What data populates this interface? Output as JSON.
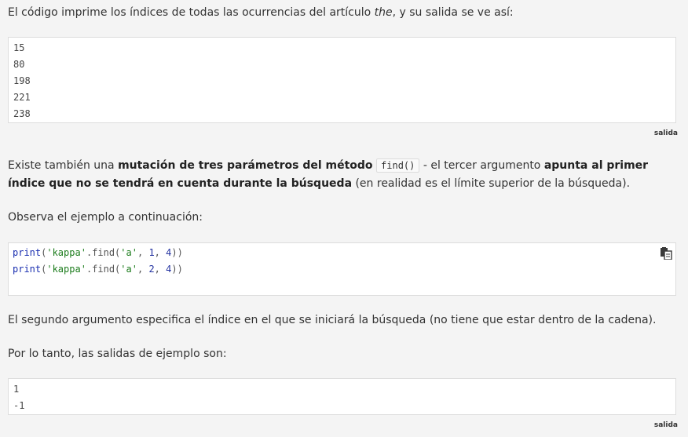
{
  "intro": {
    "pre": "El código imprime los índices de todas las ocurrencias del artículo ",
    "italic": "the",
    "post": ", y su salida se ve así:"
  },
  "output1": {
    "lines": [
      "15",
      "80",
      "198",
      "221",
      "238"
    ],
    "caption": "salida"
  },
  "mutation": {
    "t1": "Existe también una ",
    "b1": "mutación de tres parámetros del método",
    "code": "find()",
    "t2": " - el tercer argumento ",
    "b2": "apunta al primer índice que no se tendrá en cuenta durante la búsqueda",
    "t3": " (en realidad es el límite superior de la búsqueda)."
  },
  "observe": "Observa el ejemplo a continuación:",
  "code": {
    "line1": {
      "kw": "print",
      "p1": "(",
      "str": "'kappa'",
      "mid": ".find(",
      "arg": "'a'",
      "c1": ", ",
      "n1": "1",
      "c2": ", ",
      "n2": "4",
      "end": "))"
    },
    "line2": {
      "kw": "print",
      "p1": "(",
      "str": "'kappa'",
      "mid": ".find(",
      "arg": "'a'",
      "c1": ", ",
      "n1": "2",
      "c2": ", ",
      "n2": "4",
      "end": "))"
    },
    "copy_icon": "clipboard-icon"
  },
  "second_arg": "El segundo argumento especifica el índice en el que se iniciará la búsqueda (no tiene que estar dentro de la cadena).",
  "therefore": "Por lo tanto, las salidas de ejemplo son:",
  "output2": {
    "lines": [
      "1",
      "-1"
    ],
    "caption": "salida"
  },
  "colors": {
    "background": "#f4f4f4",
    "keyword": "#1a2fb0",
    "string": "#1e7d1e",
    "number": "#2332a0"
  }
}
